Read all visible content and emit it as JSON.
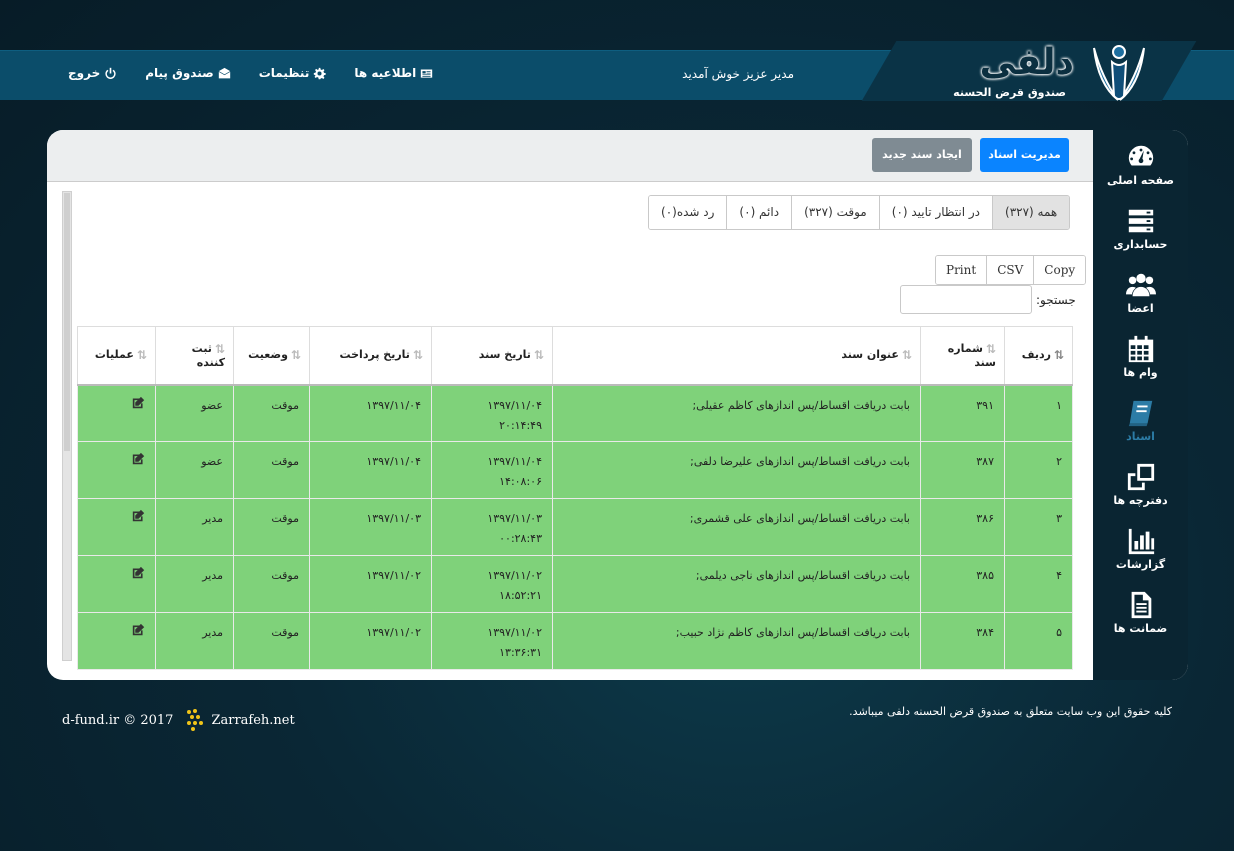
{
  "brand": {
    "logo_title": "دلفی",
    "logo_sub": "صندوق قرض الحسنه"
  },
  "header": {
    "welcome": "مدیر عزیز خوش آمدید",
    "nav": [
      {
        "label": "اطلاعیه ها",
        "icon": "newspaper-icon"
      },
      {
        "label": "تنظیمات",
        "icon": "gear-icon"
      },
      {
        "label": "صندوق پیام",
        "icon": "envelope-icon"
      },
      {
        "label": "خروج",
        "icon": "power-icon"
      }
    ]
  },
  "sidebar": {
    "items": [
      {
        "label": "صفحه اصلی",
        "icon": "dashboard-icon"
      },
      {
        "label": "حسابداری",
        "icon": "server-icon"
      },
      {
        "label": "اعضا",
        "icon": "users-icon"
      },
      {
        "label": "وام ها",
        "icon": "calendar-icon"
      },
      {
        "label": "اسناد",
        "icon": "book-icon",
        "active": true
      },
      {
        "label": "دفترچه ها",
        "icon": "clone-icon"
      },
      {
        "label": "گزارشات",
        "icon": "bar-chart-icon"
      },
      {
        "label": "ضمانت ها",
        "icon": "file-text-icon"
      }
    ]
  },
  "toolbar": {
    "manage_label": "مدیریت اسناد",
    "create_label": "ایجاد سند جدید"
  },
  "filters": [
    {
      "label": "همه (۳۲۷)",
      "active": true
    },
    {
      "label": "در انتظار تایید (۰)"
    },
    {
      "label": "موقت (۳۲۷)"
    },
    {
      "label": "دائم (۰)"
    },
    {
      "label": "رد شده(۰)"
    }
  ],
  "export": [
    "Copy",
    "CSV",
    "Print"
  ],
  "search": {
    "label": "جستجو:",
    "value": ""
  },
  "table": {
    "headers": [
      "ردیف",
      "شماره سند",
      "عنوان سند",
      "تاریخ سند",
      "تاریخ پرداخت",
      "وضعیت",
      "ثبت کننده",
      "عملیات"
    ],
    "rows": [
      {
        "idx": "۱",
        "num": "۳۹۱",
        "title": "بابت دریافت اقساط/پس اندازهای کاظم عقیلی;",
        "date": "۱۳۹۷/۱۱/۰۴",
        "time": "۲۰:۱۴:۴۹",
        "pay": "۱۳۹۷/۱۱/۰۴",
        "status": "موقت",
        "by": "عضو"
      },
      {
        "idx": "۲",
        "num": "۳۸۷",
        "title": "بابت دریافت اقساط/پس اندازهای علیرضا دلفی;",
        "date": "۱۳۹۷/۱۱/۰۴",
        "time": "۱۴:۰۸:۰۶",
        "pay": "۱۳۹۷/۱۱/۰۴",
        "status": "موقت",
        "by": "عضو"
      },
      {
        "idx": "۳",
        "num": "۳۸۶",
        "title": "بابت دریافت اقساط/پس اندازهای علی قشمری;",
        "date": "۱۳۹۷/۱۱/۰۳",
        "time": "۰۰:۲۸:۴۳",
        "pay": "۱۳۹۷/۱۱/۰۳",
        "status": "موقت",
        "by": "مدیر"
      },
      {
        "idx": "۴",
        "num": "۳۸۵",
        "title": "بابت دریافت اقساط/پس اندازهای ناجی دیلمی;",
        "date": "۱۳۹۷/۱۱/۰۲",
        "time": "۱۸:۵۲:۲۱",
        "pay": "۱۳۹۷/۱۱/۰۲",
        "status": "موقت",
        "by": "مدیر"
      },
      {
        "idx": "۵",
        "num": "۳۸۴",
        "title": "بابت دریافت اقساط/پس اندازهای کاظم نژاد حبیب;",
        "date": "۱۳۹۷/۱۱/۰۲",
        "time": "۱۳:۳۶:۳۱",
        "pay": "۱۳۹۷/۱۱/۰۲",
        "status": "موقت",
        "by": "مدیر"
      }
    ]
  },
  "footer": {
    "rights": "کلیه حقوق این وب سایت متعلق به صندوق قرض الحسنه دلفی میباشد.",
    "copyright": "d-fund.ir © 2017",
    "dev": "Zarrafeh.net"
  },
  "colors": {
    "row_bg": "#7fd27a",
    "primary": "#0a84ff",
    "sidebar": "#0a2532",
    "topbar": "#0b4d6a"
  }
}
